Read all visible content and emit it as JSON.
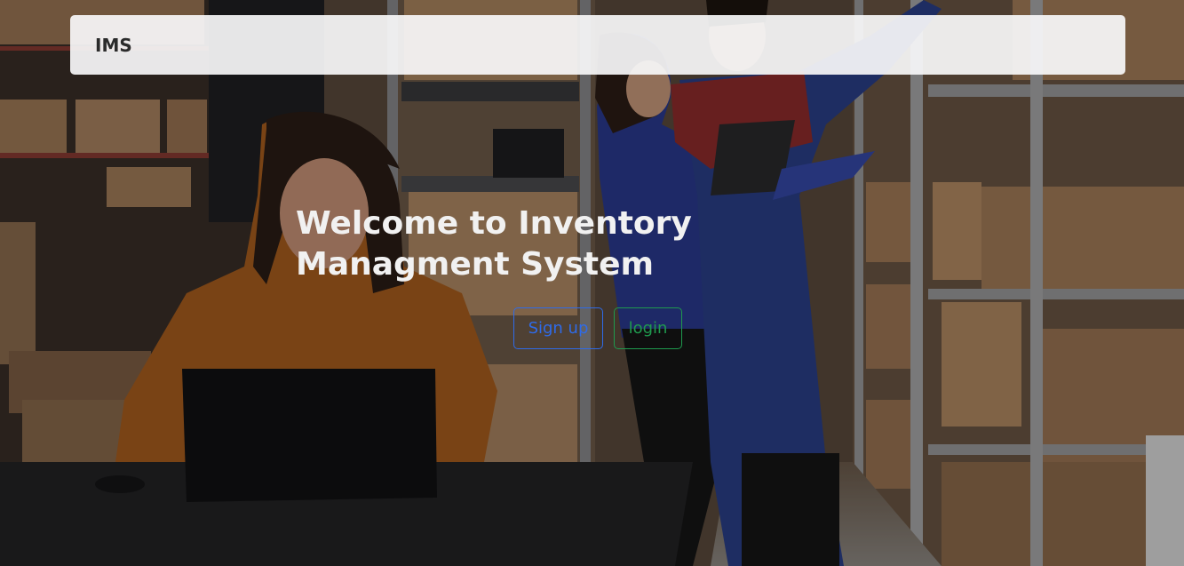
{
  "navbar": {
    "brand": "IMS"
  },
  "hero": {
    "title": "Welcome to Inventory Managment System",
    "background": "warehouse-office-photo"
  },
  "actions": {
    "signup_label": "Sign up",
    "login_label": "login"
  },
  "colors": {
    "signup": "#2f6be8",
    "login": "#1f9a4e",
    "navbar_bg": "#f8f8fa",
    "title_text": "#f1f1f1"
  }
}
